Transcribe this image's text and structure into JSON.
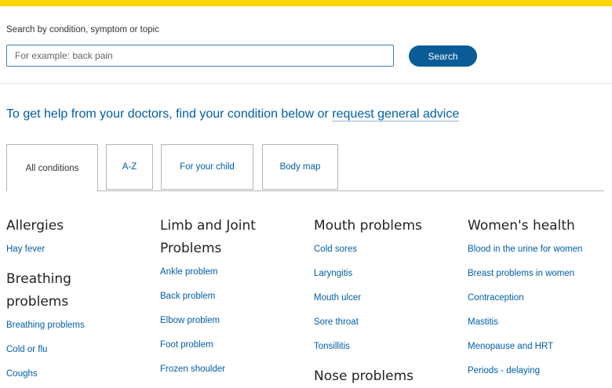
{
  "search": {
    "label": "Search by condition, symptom or topic",
    "placeholder": "For example: back pain",
    "button_label": "Search"
  },
  "help": {
    "text": "To get help from your doctors, find your condition below or ",
    "link_label": "request general advice"
  },
  "tabs": [
    {
      "label": "All conditions",
      "active": true
    },
    {
      "label": "A-Z"
    },
    {
      "label": "For your child"
    },
    {
      "label": "Body map"
    }
  ],
  "columns": [
    {
      "groups": [
        {
          "heading": "Allergies",
          "links": [
            "Hay fever"
          ]
        },
        {
          "heading": "Breathing problems",
          "links": [
            "Breathing problems",
            "Cold or flu",
            "Coughs"
          ]
        }
      ]
    },
    {
      "groups": [
        {
          "heading": "Limb and Joint Problems",
          "links": [
            "Ankle problem",
            "Back problem",
            "Elbow problem",
            "Foot problem",
            "Frozen shoulder"
          ]
        }
      ]
    },
    {
      "groups": [
        {
          "heading": "Mouth problems",
          "links": [
            "Cold sores",
            "Laryngitis",
            "Mouth ulcer",
            "Sore throat",
            "Tonsillitis"
          ]
        },
        {
          "heading": "Nose problems",
          "links": []
        }
      ]
    },
    {
      "groups": [
        {
          "heading": "Women's health",
          "links": [
            "Blood in the urine for women",
            "Breast problems in women",
            "Contraception",
            "Mastitis",
            "Menopause and HRT",
            "Periods - delaying"
          ]
        }
      ]
    }
  ]
}
